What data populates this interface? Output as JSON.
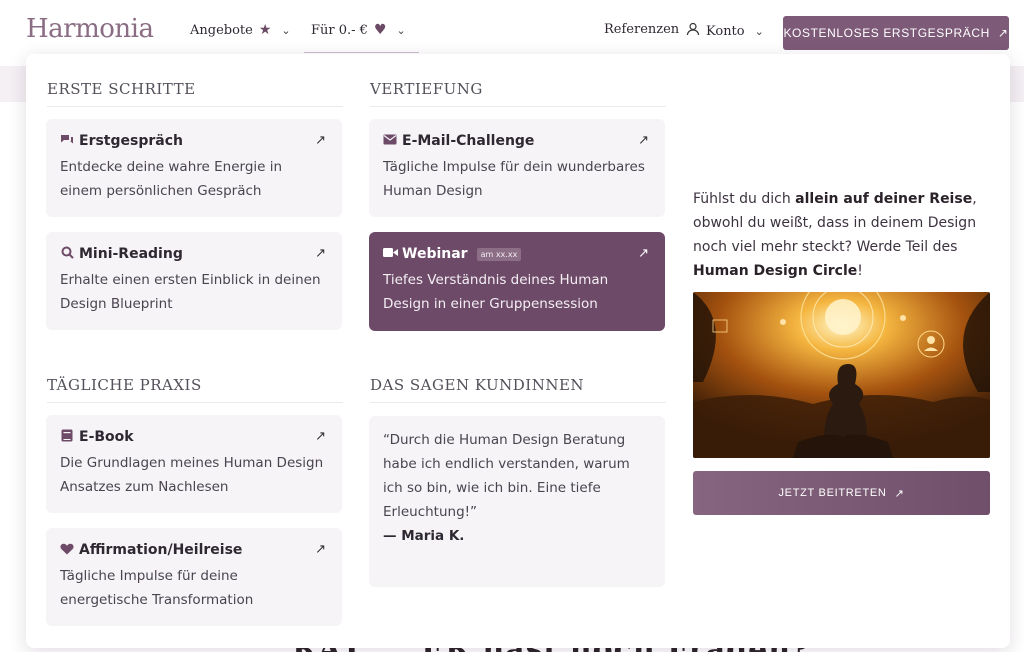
{
  "brand": {
    "logo_text": "Harmonia",
    "accent": "#7d5a78",
    "accent_dark": "#6d4b68"
  },
  "nav": {
    "offers_label": "Angebote",
    "free_label": "Für 0.- €",
    "references_label": "Referenzen",
    "account_label": "Konto",
    "cta_label": "KOSTENLOSES ERSTGESPRÄCH"
  },
  "background": {
    "headline_fragment": "RAT ... ER hast noch Fragen?"
  },
  "menu": {
    "first_steps": {
      "title": "ERSTE SCHRITTE",
      "items": [
        {
          "title": "Erstgespräch",
          "icon": "chat-icon",
          "desc": "Entdecke deine wahre Energie in einem persönlichen Gespräch"
        },
        {
          "title": "Mini-Reading",
          "icon": "search-icon",
          "desc": "Erhalte einen ersten Einblick in deinen Design Blueprint"
        }
      ]
    },
    "deepening": {
      "title": "VERTIEFUNG",
      "items": [
        {
          "title": "E-Mail-Challenge",
          "icon": "envelope-icon",
          "desc": "Tägliche Impulse für dein wunderbares Human Design"
        },
        {
          "title": "Webinar",
          "badge": "am xx.xx",
          "icon": "video-icon",
          "desc": "Tiefes Verständnis deines Human Design in einer Gruppensession"
        }
      ]
    },
    "daily_practice": {
      "title": "TÄGLICHE PRAXIS",
      "items": [
        {
          "title": "E-Book",
          "icon": "book-icon",
          "desc": "Die Grundlagen meines Human Design Ansatzes zum Nachlesen"
        },
        {
          "title": "Affirmation/Heilreise",
          "icon": "heart-icon",
          "desc": "Tägliche Impulse für deine energetische Transformation"
        }
      ]
    },
    "testimonials": {
      "title": "DAS SAGEN KUNDINNEN",
      "quote": "“Durch die Human Design Beratung habe ich endlich verstanden, warum ich so bin, wie ich bin. Eine tiefe Erleuchtung!”",
      "author": "— Maria K."
    },
    "circle": {
      "text_1": "Fühlst du dich ",
      "text_bold_1": "allein auf deiner Reise",
      "text_2": ", obwohl du weißt, dass in deinem Design noch viel mehr steckt? Werde Teil des ",
      "text_bold_2": "Human Design Circle",
      "text_3": "!",
      "button_label": "JETZT BEITRETEN"
    }
  },
  "icons": {
    "arrow": "arrow-up-right-icon"
  }
}
